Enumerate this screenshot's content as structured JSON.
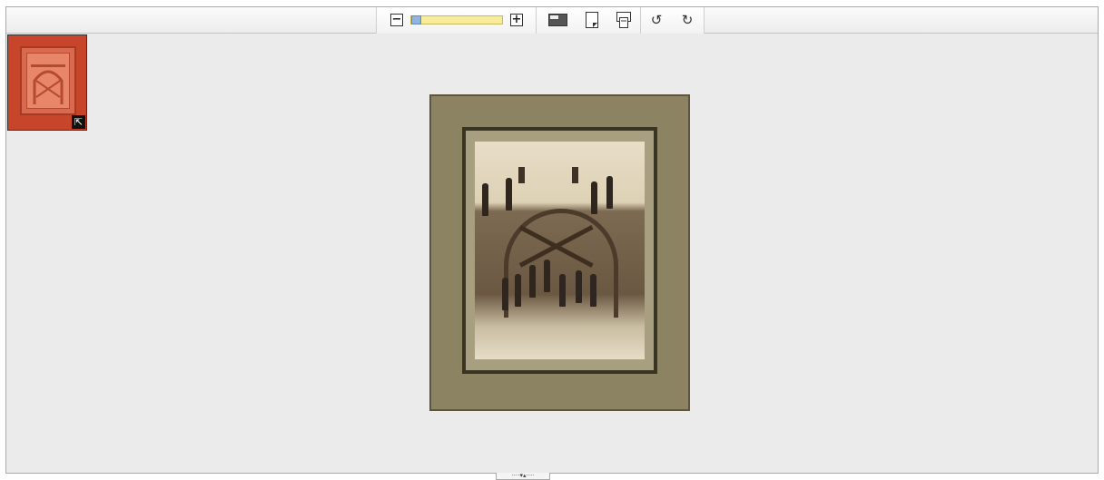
{
  "toolbar": {
    "zoom": {
      "zoom_out_icon": "minus-square-icon",
      "zoom_in_icon": "plus-square-icon",
      "level": 0.0
    },
    "view_buttons": [
      {
        "icon": "thumbnail-toggle-icon"
      },
      {
        "icon": "single-page-icon"
      },
      {
        "icon": "fit-page-icon"
      }
    ],
    "rotate": {
      "left_icon": "rotate-left-icon",
      "right_icon": "rotate-right-icon"
    }
  },
  "thumbnail": {
    "expand_icon": "expand-arrow-icon",
    "selected": true,
    "accent_color": "#c7452b"
  },
  "photo": {
    "subject": "photograph-of-workers-at-arched-doorway"
  },
  "colors": {
    "background": "#ebebeb",
    "zoom_track": "#f6ec9a",
    "zoom_thumb": "#8fb4e0"
  }
}
